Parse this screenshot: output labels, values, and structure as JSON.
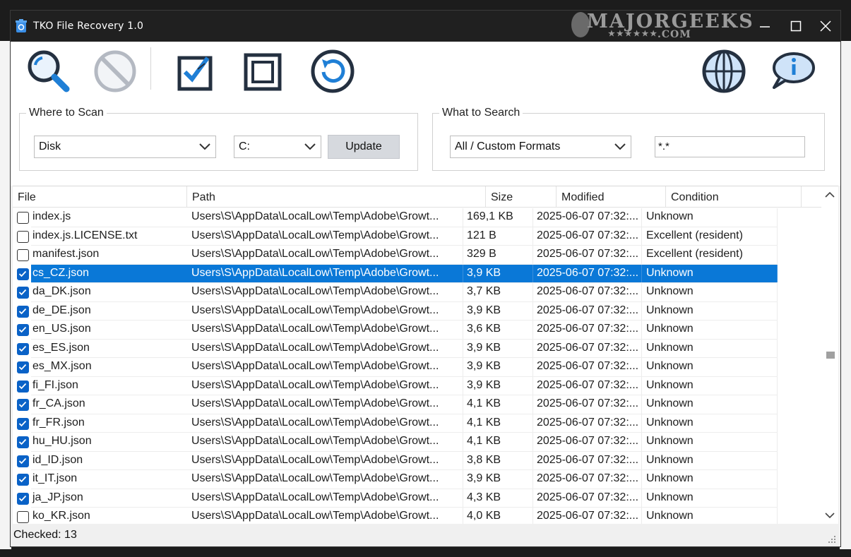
{
  "window": {
    "title": "TKO File Recovery 1.0",
    "watermark": {
      "main": "MAJORGEEKS",
      "sub": ".COM",
      "stars": "★★★★★★"
    }
  },
  "colors": {
    "accent": "#0a78d7",
    "icon_blue": "#1f7fd6",
    "icon_dark": "#243040",
    "titlebar": "#202020"
  },
  "toolbar": {
    "icons": [
      "search-icon",
      "cancel-icon",
      "check-all-icon",
      "uncheck-all-icon",
      "recover-icon",
      "website-icon",
      "about-icon"
    ]
  },
  "where": {
    "title": "Where to Scan",
    "source": "Disk",
    "drive": "C:",
    "update_label": "Update"
  },
  "what": {
    "title": "What to Search",
    "format": "All / Custom Formats",
    "mask": "*.*"
  },
  "list": {
    "columns": [
      "File",
      "Path",
      "Size",
      "Modified",
      "Condition"
    ],
    "rows": [
      {
        "checked": false,
        "selected": false,
        "file": "index.js",
        "path": "Users\\S\\AppData\\LocalLow\\Temp\\Adobe\\Growt...",
        "size": "169,1 KB",
        "modified": "2025-06-07 07:32:...",
        "condition": "Unknown"
      },
      {
        "checked": false,
        "selected": false,
        "file": "index.js.LICENSE.txt",
        "path": "Users\\S\\AppData\\LocalLow\\Temp\\Adobe\\Growt...",
        "size": "121 B",
        "modified": "2025-06-07 07:32:...",
        "condition": "Excellent (resident)"
      },
      {
        "checked": false,
        "selected": false,
        "file": "manifest.json",
        "path": "Users\\S\\AppData\\LocalLow\\Temp\\Adobe\\Growt...",
        "size": "329 B",
        "modified": "2025-06-07 07:32:...",
        "condition": "Excellent (resident)"
      },
      {
        "checked": true,
        "selected": true,
        "file": "cs_CZ.json",
        "path": "Users\\S\\AppData\\LocalLow\\Temp\\Adobe\\Growt...",
        "size": "3,9 KB",
        "modified": "2025-06-07 07:32:...",
        "condition": "Unknown"
      },
      {
        "checked": true,
        "selected": false,
        "file": "da_DK.json",
        "path": "Users\\S\\AppData\\LocalLow\\Temp\\Adobe\\Growt...",
        "size": "3,7 KB",
        "modified": "2025-06-07 07:32:...",
        "condition": "Unknown"
      },
      {
        "checked": true,
        "selected": false,
        "file": "de_DE.json",
        "path": "Users\\S\\AppData\\LocalLow\\Temp\\Adobe\\Growt...",
        "size": "3,9 KB",
        "modified": "2025-06-07 07:32:...",
        "condition": "Unknown"
      },
      {
        "checked": true,
        "selected": false,
        "file": "en_US.json",
        "path": "Users\\S\\AppData\\LocalLow\\Temp\\Adobe\\Growt...",
        "size": "3,6 KB",
        "modified": "2025-06-07 07:32:...",
        "condition": "Unknown"
      },
      {
        "checked": true,
        "selected": false,
        "file": "es_ES.json",
        "path": "Users\\S\\AppData\\LocalLow\\Temp\\Adobe\\Growt...",
        "size": "3,9 KB",
        "modified": "2025-06-07 07:32:...",
        "condition": "Unknown"
      },
      {
        "checked": true,
        "selected": false,
        "file": "es_MX.json",
        "path": "Users\\S\\AppData\\LocalLow\\Temp\\Adobe\\Growt...",
        "size": "3,9 KB",
        "modified": "2025-06-07 07:32:...",
        "condition": "Unknown"
      },
      {
        "checked": true,
        "selected": false,
        "file": "fi_FI.json",
        "path": "Users\\S\\AppData\\LocalLow\\Temp\\Adobe\\Growt...",
        "size": "3,9 KB",
        "modified": "2025-06-07 07:32:...",
        "condition": "Unknown"
      },
      {
        "checked": true,
        "selected": false,
        "file": "fr_CA.json",
        "path": "Users\\S\\AppData\\LocalLow\\Temp\\Adobe\\Growt...",
        "size": "4,1 KB",
        "modified": "2025-06-07 07:32:...",
        "condition": "Unknown"
      },
      {
        "checked": true,
        "selected": false,
        "file": "fr_FR.json",
        "path": "Users\\S\\AppData\\LocalLow\\Temp\\Adobe\\Growt...",
        "size": "4,1 KB",
        "modified": "2025-06-07 07:32:...",
        "condition": "Unknown"
      },
      {
        "checked": true,
        "selected": false,
        "file": "hu_HU.json",
        "path": "Users\\S\\AppData\\LocalLow\\Temp\\Adobe\\Growt...",
        "size": "4,1 KB",
        "modified": "2025-06-07 07:32:...",
        "condition": "Unknown"
      },
      {
        "checked": true,
        "selected": false,
        "file": "id_ID.json",
        "path": "Users\\S\\AppData\\LocalLow\\Temp\\Adobe\\Growt...",
        "size": "3,8 KB",
        "modified": "2025-06-07 07:32:...",
        "condition": "Unknown"
      },
      {
        "checked": true,
        "selected": false,
        "file": "it_IT.json",
        "path": "Users\\S\\AppData\\LocalLow\\Temp\\Adobe\\Growt...",
        "size": "3,9 KB",
        "modified": "2025-06-07 07:32:...",
        "condition": "Unknown"
      },
      {
        "checked": true,
        "selected": false,
        "file": "ja_JP.json",
        "path": "Users\\S\\AppData\\LocalLow\\Temp\\Adobe\\Growt...",
        "size": "4,3 KB",
        "modified": "2025-06-07 07:32:...",
        "condition": "Unknown"
      },
      {
        "checked": false,
        "selected": false,
        "file": "ko_KR.json",
        "path": "Users\\S\\AppData\\LocalLow\\Temp\\Adobe\\Growt...",
        "size": "4,0 KB",
        "modified": "2025-06-07 07:32:...",
        "condition": "Unknown"
      }
    ]
  },
  "status": {
    "checked_text": "Checked: 13"
  }
}
